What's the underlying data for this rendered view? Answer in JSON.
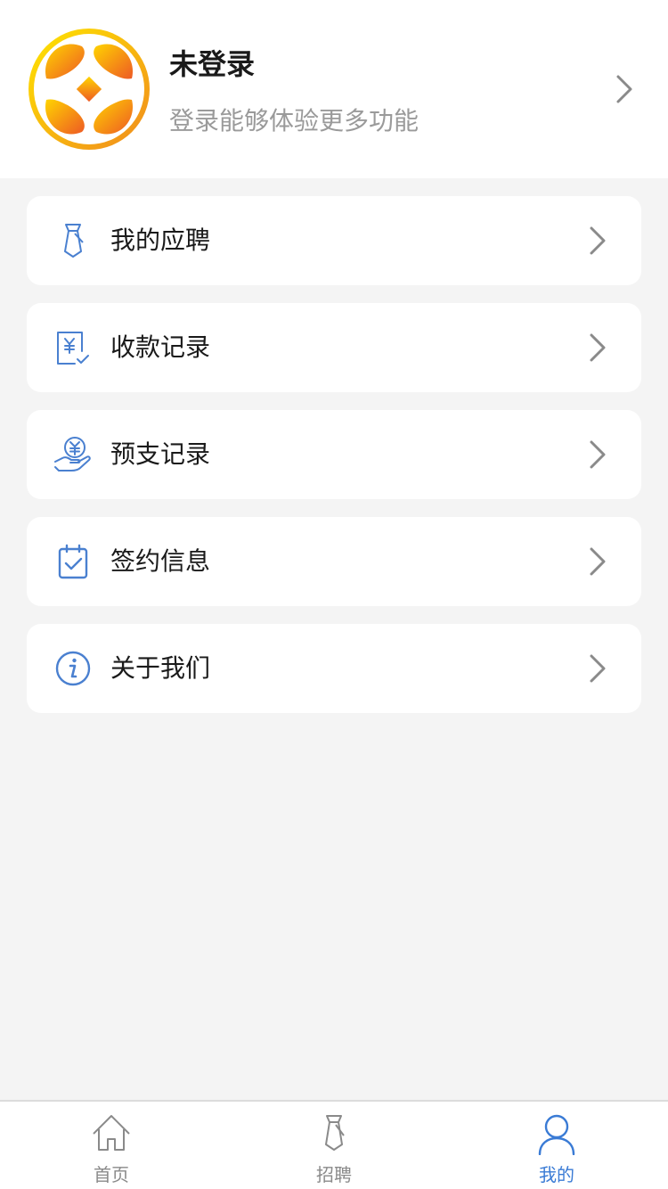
{
  "theme": {
    "accent": "#3a7bd5",
    "icon_color": "#4a80d0",
    "chevron_color": "#8a8a8a"
  },
  "profile": {
    "name": "未登录",
    "hint": "登录能够体验更多功能",
    "avatar_icon": "coin-logo-icon"
  },
  "menu": [
    {
      "id": "applications",
      "label": "我的应聘",
      "icon": "necktie-icon"
    },
    {
      "id": "payments",
      "label": "收款记录",
      "icon": "receipt-yuan-icon"
    },
    {
      "id": "advances",
      "label": "预支记录",
      "icon": "hand-yuan-icon"
    },
    {
      "id": "contract",
      "label": "签约信息",
      "icon": "calendar-check-icon"
    },
    {
      "id": "about",
      "label": "关于我们",
      "icon": "info-icon"
    }
  ],
  "tabbar": {
    "active": "mine",
    "tabs": [
      {
        "id": "home",
        "label": "首页",
        "icon": "home-icon"
      },
      {
        "id": "jobs",
        "label": "招聘",
        "icon": "necktie-icon"
      },
      {
        "id": "mine",
        "label": "我的",
        "icon": "user-icon"
      }
    ]
  }
}
